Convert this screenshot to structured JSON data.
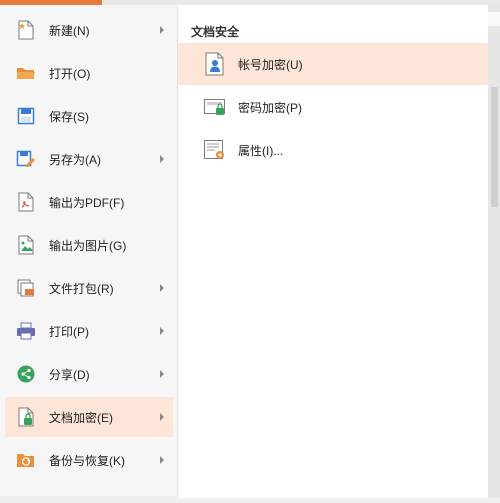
{
  "menu": {
    "items": [
      {
        "label": "新建(N)",
        "icon": "new-file-icon",
        "has_submenu": true
      },
      {
        "label": "打开(O)",
        "icon": "open-folder-icon",
        "has_submenu": false
      },
      {
        "label": "保存(S)",
        "icon": "save-icon",
        "has_submenu": false
      },
      {
        "label": "另存为(A)",
        "icon": "save-as-icon",
        "has_submenu": true
      },
      {
        "label": "输出为PDF(F)",
        "icon": "export-pdf-icon",
        "has_submenu": false
      },
      {
        "label": "输出为图片(G)",
        "icon": "export-image-icon",
        "has_submenu": false
      },
      {
        "label": "文件打包(R)",
        "icon": "package-icon",
        "has_submenu": true
      },
      {
        "label": "打印(P)",
        "icon": "print-icon",
        "has_submenu": true
      },
      {
        "label": "分享(D)",
        "icon": "share-icon",
        "has_submenu": true
      },
      {
        "label": "文档加密(E)",
        "icon": "encrypt-document-icon",
        "has_submenu": true
      },
      {
        "label": "备份与恢复(K)",
        "icon": "backup-restore-icon",
        "has_submenu": true
      }
    ],
    "active_index": 9
  },
  "submenu": {
    "title": "文档安全",
    "items": [
      {
        "label": "帐号加密(U)",
        "icon": "account-encrypt-icon"
      },
      {
        "label": "密码加密(P)",
        "icon": "password-encrypt-icon"
      },
      {
        "label": "属性(I)...",
        "icon": "properties-icon"
      }
    ],
    "active_index": 0
  },
  "colors": {
    "accent": "#e8793c",
    "highlight": "#fde6d8"
  }
}
